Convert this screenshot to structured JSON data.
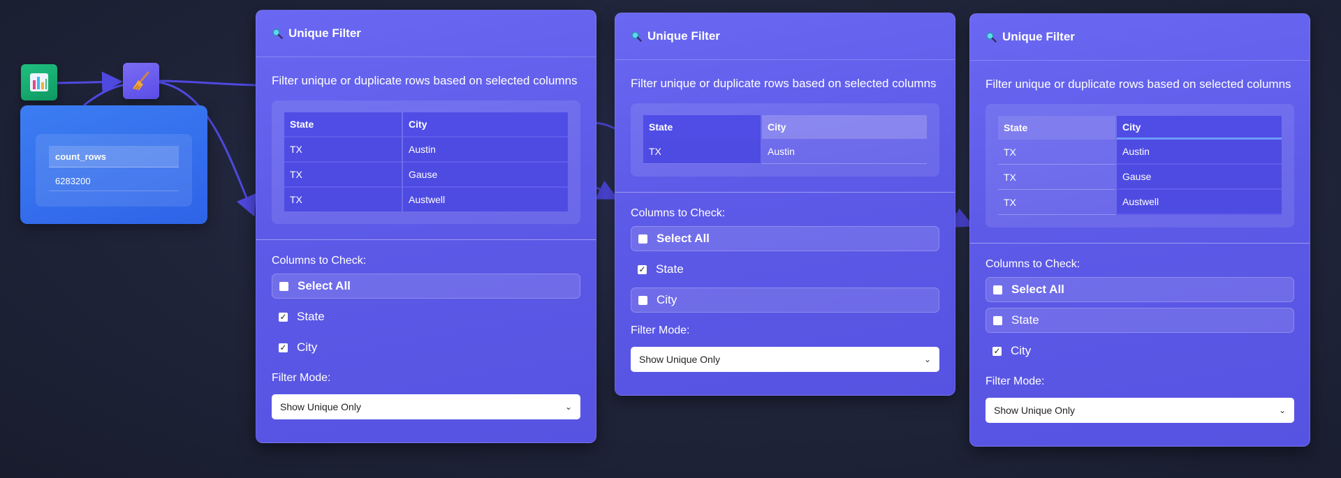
{
  "count_node": {
    "column": "count_rows",
    "value": "6283200"
  },
  "panels": [
    {
      "title": "Unique Filter",
      "description": "Filter unique or duplicate rows based on selected columns",
      "columns": [
        "State",
        "City"
      ],
      "rows": [
        [
          "TX",
          "Austin"
        ],
        [
          "TX",
          "Gause"
        ],
        [
          "TX",
          "Austwell"
        ]
      ],
      "columns_label": "Columns to Check:",
      "options": [
        {
          "label": "Select All",
          "checked": false
        },
        {
          "label": "State",
          "checked": true
        },
        {
          "label": "City",
          "checked": true
        }
      ],
      "mode_label": "Filter Mode:",
      "mode_value": "Show Unique Only"
    },
    {
      "title": "Unique Filter",
      "description": "Filter unique or duplicate rows based on selected columns",
      "columns": [
        "State",
        "City"
      ],
      "rows": [
        [
          "TX",
          "Austin"
        ]
      ],
      "columns_label": "Columns to Check:",
      "options": [
        {
          "label": "Select All",
          "checked": false
        },
        {
          "label": "State",
          "checked": true
        },
        {
          "label": "City",
          "checked": false
        }
      ],
      "mode_label": "Filter Mode:",
      "mode_value": "Show Unique Only"
    },
    {
      "title": "Unique Filter",
      "description": "Filter unique or duplicate rows based on selected columns",
      "columns": [
        "State",
        "City"
      ],
      "rows": [
        [
          "TX",
          "Austin"
        ],
        [
          "TX",
          "Gause"
        ],
        [
          "TX",
          "Austwell"
        ]
      ],
      "columns_label": "Columns to Check:",
      "options": [
        {
          "label": "Select All",
          "checked": false
        },
        {
          "label": "State",
          "checked": false
        },
        {
          "label": "City",
          "checked": true
        }
      ],
      "mode_label": "Filter Mode:",
      "mode_value": "Show Unique Only"
    }
  ],
  "icons": {
    "chart_node": "bar-chart-icon",
    "broom_node": "broom-icon",
    "panel_title": "magnifier-icon"
  },
  "colors": {
    "panel": "#5e5be9",
    "count_node": "#3573ee",
    "chart_node": "#17b174",
    "broom_node": "#6b5ef0",
    "edge": "#4f49e0"
  }
}
